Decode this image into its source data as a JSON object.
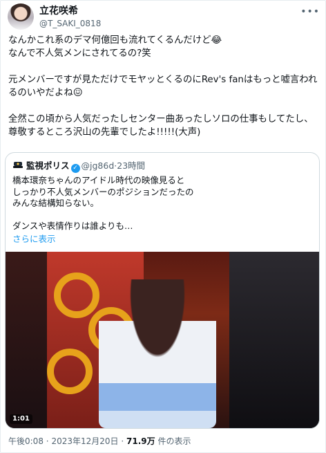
{
  "author": {
    "name": "立花咲希",
    "handle": "@T_SAKI_0818",
    "avatar_icon": "avatar-photo"
  },
  "tweet": {
    "lines": [
      "なんかこれ系のデマ何億回も流れてくるんだけど😂",
      "なんで不人気メンにされてるの?笑",
      "",
      "元メンバーですが見ただけでモヤッとくるのにRev's fanはもっと嘘言われ",
      "るのいやだよね😖",
      "",
      "全然この頃から人気だったしセンター曲あったしソロの仕事もしてたし、",
      "尊敬するところ沢山の先輩でしたよ!!!!!(大声)"
    ]
  },
  "quote": {
    "name": "監視ポリス",
    "handle": "@jg86d",
    "separator": "·",
    "time": "23時間",
    "lines": [
      "橋本環奈ちゃんのアイドル時代の映像見ると",
      "しっかり不人気メンバーのポジションだったの",
      "みんな結構知らない。",
      "",
      "ダンスや表情作りは誰よりも…"
    ],
    "show_more": "さらに表示",
    "video_duration": "1:01"
  },
  "footer": {
    "time": "午後0:08",
    "sep1": "·",
    "date": "2023年12月20日",
    "sep2": "·",
    "views": "71.9万",
    "views_label": "件の表示"
  },
  "colors": {
    "link": "#1d9bf0",
    "muted": "#536471",
    "text": "#0f1419",
    "border": "#cfd9de"
  }
}
